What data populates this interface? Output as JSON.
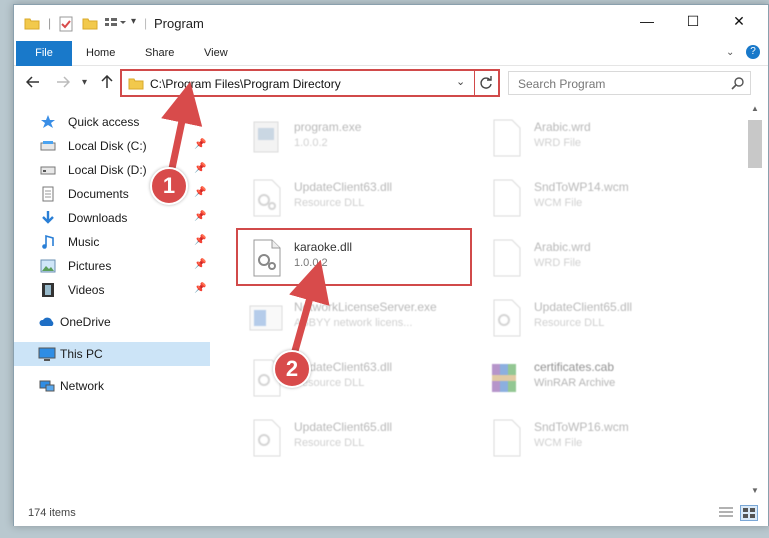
{
  "window": {
    "title": "Program",
    "controls": {
      "minimize": "—",
      "maximize": "☐",
      "close": "✕"
    }
  },
  "ribbon": {
    "tabs": [
      "File",
      "Home",
      "Share",
      "View"
    ]
  },
  "addressbar": {
    "path": "C:\\Program Files\\Program Directory",
    "search_placeholder": "Search Program"
  },
  "nav": {
    "items": [
      {
        "label": "Quick access",
        "icon": "star-icon",
        "pinned": false
      },
      {
        "label": "Local Disk (C:)",
        "icon": "drive-icon",
        "pinned": true
      },
      {
        "label": "Local Disk (D:)",
        "icon": "drive-icon",
        "pinned": true
      },
      {
        "label": "Documents",
        "icon": "documents-icon",
        "pinned": true
      },
      {
        "label": "Downloads",
        "icon": "download-icon",
        "pinned": true
      },
      {
        "label": "Music",
        "icon": "music-icon",
        "pinned": true
      },
      {
        "label": "Pictures",
        "icon": "pictures-icon",
        "pinned": true
      },
      {
        "label": "Videos",
        "icon": "videos-icon",
        "pinned": true
      },
      {
        "label": "OneDrive",
        "icon": "cloud-icon",
        "pinned": false
      },
      {
        "label": "This PC",
        "icon": "computer-icon",
        "pinned": false,
        "selected": true
      },
      {
        "label": "Network",
        "icon": "network-icon",
        "pinned": false
      }
    ]
  },
  "files": [
    {
      "name": "program.exe",
      "sub": "1.0.0.2",
      "icon": "exe-icon",
      "faded": true
    },
    {
      "name": "Arabic.wrd",
      "sub": "WRD File",
      "icon": "blank-file-icon",
      "faded": true
    },
    {
      "name": "UpdateClient63.dll",
      "sub": "Resource DLL",
      "icon": "dll-icon",
      "faded": true
    },
    {
      "name": "SndToWP14.wcm",
      "sub": "WCM File",
      "icon": "blank-file-icon",
      "faded": true
    },
    {
      "name": "karaoke.dll",
      "sub": "1.0.0.2",
      "icon": "dll-icon",
      "faded": false
    },
    {
      "name": "Arabic.wrd",
      "sub": "WRD File",
      "icon": "blank-file-icon",
      "faded": true
    },
    {
      "name": "NetworkLicenseServer.exe",
      "sub": "ABBYY network licens...",
      "icon": "exe-icon",
      "faded": true
    },
    {
      "name": "UpdateClient65.dll",
      "sub": "Resource DLL",
      "icon": "dll-icon",
      "faded": true
    },
    {
      "name": "UpdateClient63.dll",
      "sub": "Resource DLL",
      "icon": "dll-icon",
      "faded": true
    },
    {
      "name": "certificates.cab",
      "sub": "WinRAR Archive",
      "icon": "archive-icon",
      "faded": true
    },
    {
      "name": "UpdateClient65.dll",
      "sub": "Resource DLL",
      "icon": "dll-icon",
      "faded": true
    },
    {
      "name": "SndToWP16.wcm",
      "sub": "WCM File",
      "icon": "blank-file-icon",
      "faded": true
    }
  ],
  "status": {
    "item_count": "174 items"
  },
  "annotations": {
    "step1": "1",
    "step2": "2",
    "accent": "#d84b4b"
  }
}
